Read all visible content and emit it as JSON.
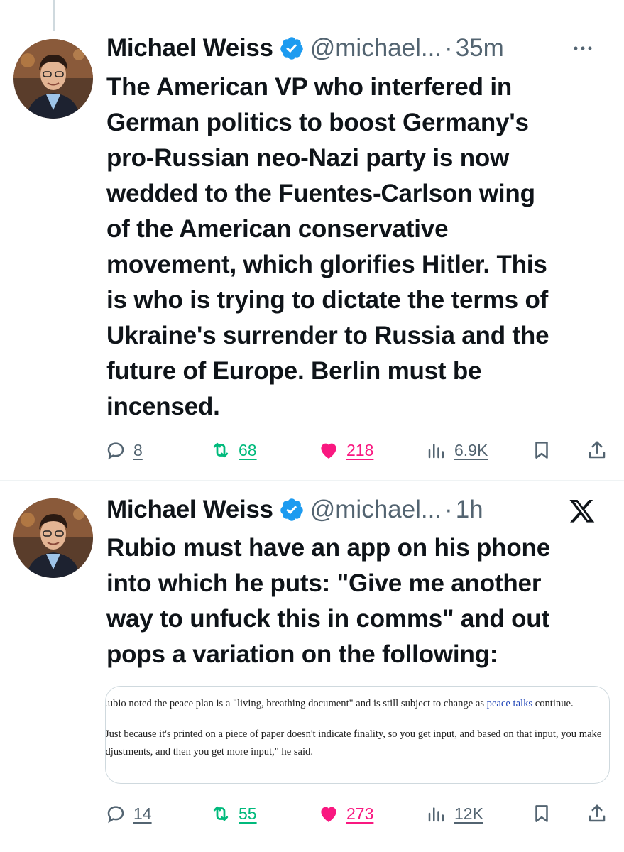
{
  "tweets": [
    {
      "author_name": "Michael Weiss",
      "handle": "@michael...",
      "separator": "·",
      "time": "35m",
      "text": "The American VP who interfered in\nGerman politics to boost Germany's\npro-Russian neo-Nazi party is now\nwedded to the Fuentes-Carlson wing\nof the American conservative\nmovement, which glorifies Hitler. This\nis who is trying to dictate the terms of\nUkraine's surrender to Russia and the\nfuture of Europe. Berlin must be\nincensed.",
      "replies": "8",
      "reposts": "68",
      "likes": "218",
      "views": "6.9K",
      "icons": {
        "verified": "verified-badge-icon",
        "more": "more-dots-icon",
        "reply": "reply-icon",
        "repost": "repost-icon",
        "like": "heart-icon",
        "views": "views-chart-icon",
        "bookmark": "bookmark-icon",
        "share": "share-icon"
      }
    },
    {
      "author_name": "Michael Weiss",
      "handle": "@michael...",
      "separator": "·",
      "time": "1h",
      "text": "Rubio must have an app on his phone\ninto which he puts: \"Give me another\nway to unfuck this in comms\" and out\npops a variation on the following:",
      "quote": {
        "para1_start": "Rubio noted the peace plan is a \"living, breathing document\" and is still subject to change as ",
        "para1_link": "peace talks",
        "para1_end": " continue.",
        "para2": "\"Just because it's printed on a piece of paper doesn't indicate finality, so you get input, and based on that input, you make adjustments, and then you get more input,\" he said."
      },
      "replies": "14",
      "reposts": "55",
      "likes": "273",
      "views": "12K",
      "icons": {
        "verified": "verified-badge-icon",
        "platform": "x-logo-icon"
      }
    }
  ],
  "colors": {
    "text": "#0f1419",
    "secondary": "#536471",
    "verified": "#1d9bf0",
    "repost": "#00ba7c",
    "like": "#f91880",
    "link": "#2348b8"
  }
}
